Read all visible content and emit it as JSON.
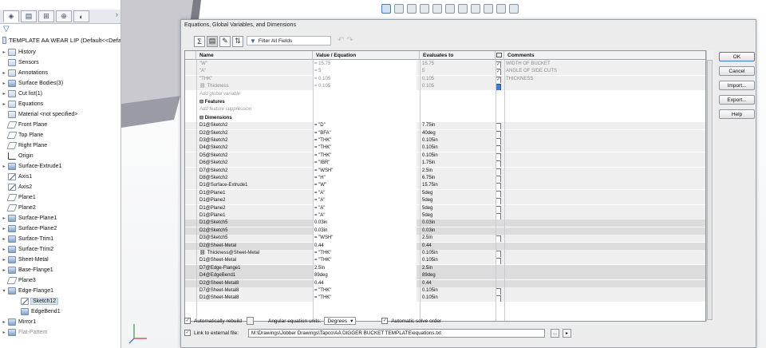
{
  "tree": {
    "root_label": "TEMPLATE AA WEAR LIP  (Default<<Defa",
    "items": [
      {
        "label": "History",
        "icon": "history-icon",
        "exp": "▸"
      },
      {
        "label": "Sensors",
        "icon": "sensor-icon",
        "exp": ""
      },
      {
        "label": "Annotations",
        "icon": "annotation-icon",
        "exp": "▸"
      },
      {
        "label": "Surface Bodies(3)",
        "icon": "surface-bodies-icon",
        "exp": "▸"
      },
      {
        "label": "Cut list(1)",
        "icon": "cut-list-icon",
        "exp": "▸"
      },
      {
        "label": "Equations",
        "icon": "equations-icon",
        "exp": "▸"
      },
      {
        "label": "Material <not specified>",
        "icon": "material-icon",
        "exp": ""
      },
      {
        "label": "Front Plane",
        "icon": "plane-icon",
        "exp": ""
      },
      {
        "label": "Top Plane",
        "icon": "plane-icon",
        "exp": ""
      },
      {
        "label": "Right Plane",
        "icon": "plane-icon",
        "exp": ""
      },
      {
        "label": "Origin",
        "icon": "origin-icon",
        "exp": ""
      },
      {
        "label": "Surface-Extrude1",
        "icon": "surface-extrude-icon",
        "exp": "▸"
      },
      {
        "label": "Axis1",
        "icon": "axis-icon",
        "exp": ""
      },
      {
        "label": "Axis2",
        "icon": "axis-icon",
        "exp": ""
      },
      {
        "label": "Plane1",
        "icon": "plane-icon",
        "exp": ""
      },
      {
        "label": "Plane2",
        "icon": "plane-icon",
        "exp": ""
      },
      {
        "label": "Surface-Plane1",
        "icon": "surface-plane-icon",
        "exp": "▸"
      },
      {
        "label": "Surface-Plane2",
        "icon": "surface-plane-icon",
        "exp": "▸"
      },
      {
        "label": "Surface-Trim1",
        "icon": "surface-trim-icon",
        "exp": "▸"
      },
      {
        "label": "Surface-Trim2",
        "icon": "surface-trim-icon",
        "exp": "▸"
      },
      {
        "label": "Sheet-Metal",
        "icon": "sheet-metal-icon",
        "exp": "▸"
      },
      {
        "label": "Base-Flange1",
        "icon": "base-flange-icon",
        "exp": "▸"
      },
      {
        "label": "Plane3",
        "icon": "plane-icon",
        "exp": ""
      },
      {
        "label": "Edge-Flange1",
        "icon": "edge-flange-icon",
        "exp": "▾"
      },
      {
        "label": "Sketch12",
        "icon": "sketch-icon",
        "exp": "",
        "indent": true,
        "selected": true
      },
      {
        "label": "EdgeBend1",
        "icon": "edge-bend-icon",
        "exp": "",
        "indent": true
      },
      {
        "label": "Mirror1",
        "icon": "mirror-icon",
        "exp": "▸"
      },
      {
        "label": "Flat-Pattern",
        "icon": "flat-pattern-icon",
        "exp": "▸",
        "grey": true
      }
    ]
  },
  "dialog": {
    "title": "Equations, Global Variables, and Dimensions",
    "filter_placeholder": "Filter All Fields",
    "columns": {
      "name": "Name",
      "value": "Value / Equation",
      "evaluates": "Evaluates to",
      "comments": "Comments"
    },
    "globals": [
      {
        "name": "\"W\"",
        "value": "= 15.75",
        "eval": "15.75",
        "checked": true,
        "comment": "WIDTH OF BUCKET"
      },
      {
        "name": "\"A\"",
        "value": "= 5",
        "eval": "5",
        "checked": true,
        "comment": "ANGLE OF SIDE CUTS"
      },
      {
        "name": "\"THK\"",
        "value": "= 0.105",
        "eval": "0.105",
        "checked": true,
        "comment": "THICKNESS"
      },
      {
        "name": "Thickness",
        "value": "= 0.105",
        "eval": "0.105",
        "checked": false,
        "comment": "",
        "selected": true
      }
    ],
    "add_global_hint": "Add global variable",
    "features_label": "Features",
    "add_feature_hint": "Add feature suppression",
    "dimensions_label": "Dimensions",
    "dimensions": [
      {
        "name": "D1@Sketch2",
        "value": "= \"D\"",
        "eval": "7.75in",
        "cb": true
      },
      {
        "name": "D2@Sketch2",
        "value": "= \"BFA\"",
        "eval": "40deg",
        "cb": true
      },
      {
        "name": "D3@Sketch2",
        "value": "= \"THK\"",
        "eval": "0.105in",
        "cb": true
      },
      {
        "name": "D4@Sketch2",
        "value": "= \"THK\"",
        "eval": "0.105in",
        "cb": true
      },
      {
        "name": "D5@Sketch2",
        "value": "= \"THK\"",
        "eval": "0.105in",
        "cb": true
      },
      {
        "name": "D6@Sketch2",
        "value": "= \"IBR\"",
        "eval": "1.75in",
        "cb": true
      },
      {
        "name": "D7@Sketch2",
        "value": "= \"WSH\"",
        "eval": "2.5in",
        "cb": true
      },
      {
        "name": "D8@Sketch2",
        "value": "= \"H\"",
        "eval": "6.75in",
        "cb": true
      },
      {
        "name": "D1@Surface-Extrude1",
        "value": "= \"W\"",
        "eval": "15.75in",
        "cb": true
      },
      {
        "name": "D1@Plane1",
        "value": "= \"A\"",
        "eval": "5deg",
        "cb": true
      },
      {
        "name": "D1@Plane2",
        "value": "= \"A\"",
        "eval": "5deg",
        "cb": true
      },
      {
        "name": "D1@Plane2",
        "value": "= \"A\"",
        "eval": "5deg",
        "cb": true
      },
      {
        "name": "D1@Plane1",
        "value": "= \"A\"",
        "eval": "5deg",
        "cb": true
      },
      {
        "name": "D1@Sketch5",
        "value": "0.03in",
        "eval": "0.03in",
        "cb": false
      },
      {
        "name": "D2@Sketch5",
        "value": "0.03in",
        "eval": "0.03in",
        "cb": false
      },
      {
        "name": "D3@Sketch5",
        "value": "= \"WSH\"",
        "eval": "2.5in",
        "cb": true
      },
      {
        "name": "D2@Sheet-Metal",
        "value": "0.44",
        "eval": "0.44",
        "cb": false
      },
      {
        "name": "Thickness@Sheet-Metal",
        "value": "= \"THK\"",
        "eval": "0.105in",
        "cb": true,
        "link": true
      },
      {
        "name": "D1@Sheet-Metal",
        "value": "= \"THK\"",
        "eval": "0.105in",
        "cb": true
      },
      {
        "name": "D7@Edge-Flange1",
        "value": "2.5in",
        "eval": "2.5in",
        "cb": false
      },
      {
        "name": "D4@EdgeBend1",
        "value": "89deg",
        "eval": "89deg",
        "cb": false
      },
      {
        "name": "D2@Sheet-Metal8",
        "value": "0.44",
        "eval": "0.44",
        "cb": false
      },
      {
        "name": "D7@Sheet-Metal8",
        "value": "= \"THK\"",
        "eval": "0.105in",
        "cb": true
      },
      {
        "name": "D1@Sheet-Metal8",
        "value": "= \"THK\"",
        "eval": "0.105in",
        "cb": true
      }
    ],
    "buttons": {
      "ok": "OK",
      "cancel": "Cancel",
      "import": "Import...",
      "export": "Export...",
      "help": "Help"
    },
    "auto_rebuild_label": "Automatically rebuild",
    "angular_units_label": "Angular equation units:",
    "angular_units_value": "Degrees",
    "auto_solve_label": "Automatic solve order",
    "link_label": "Link to external file:",
    "link_path": "M:\\Drawings\\Jobber Drawings\\Tapco\\AA DIGGER BUCKET TEMPLATE\\equations.txt",
    "browse_label": "...",
    "auto_rebuild": true,
    "auto_solve": true,
    "link_external": true
  }
}
